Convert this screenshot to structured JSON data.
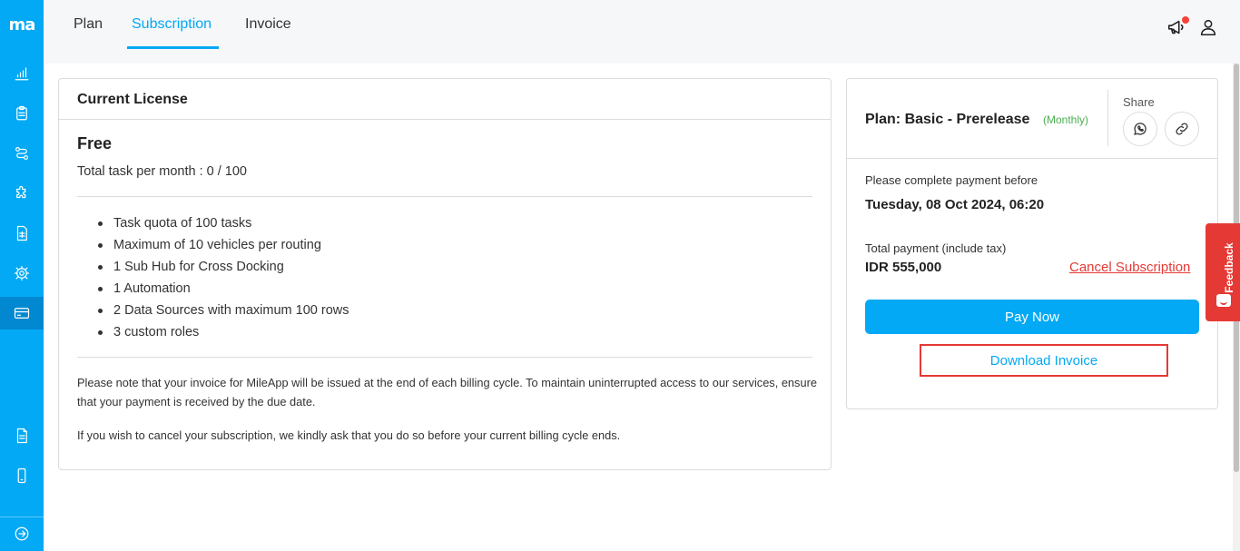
{
  "app": {
    "logo_text": "ma"
  },
  "sidebar": {
    "items": [
      {
        "icon": "bar-chart-icon"
      },
      {
        "icon": "clipboard-icon"
      },
      {
        "icon": "route-icon"
      },
      {
        "icon": "puzzle-icon"
      },
      {
        "icon": "spreadsheet-icon"
      },
      {
        "icon": "gear-icon"
      },
      {
        "icon": "credit-card-icon",
        "active": true
      },
      {
        "icon": "document-icon"
      },
      {
        "icon": "mobile-icon"
      },
      {
        "icon": "arrow-right-circle-icon"
      }
    ]
  },
  "header": {
    "tabs": [
      {
        "label": "Plan"
      },
      {
        "label": "Subscription",
        "active": true
      },
      {
        "label": "Invoice"
      }
    ]
  },
  "license": {
    "title": "Current License",
    "plan": "Free",
    "quota": "Total task per month : 0 / 100",
    "features": [
      "Task quota of 100 tasks",
      "Maximum of 10 vehicles per routing",
      "1 Sub Hub for Cross Docking",
      "1 Automation",
      "2 Data Sources with maximum 100 rows",
      "3 custom roles"
    ],
    "note1": "Please note that your invoice for MileApp will be issued at the end of each billing cycle. To maintain uninterrupted access to our services, ensure that your payment is received by the due date.",
    "note2": "If you wish to cancel your subscription, we kindly ask that you do so before your current billing cycle ends."
  },
  "payment": {
    "plan_name": "Plan: Basic - Prerelease",
    "cycle": "(Monthly)",
    "share_label": "Share",
    "due_label": "Please complete payment before",
    "due_date": "Tuesday, 08 Oct 2024, 06:20",
    "total_label": "Total payment (include tax)",
    "amount": "IDR 555,000",
    "cancel_label": "Cancel Subscription",
    "pay_label": "Pay Now",
    "download_label": "Download Invoice"
  },
  "feedback": {
    "label": "Feedback"
  },
  "colors": {
    "accent": "#03a9f4",
    "danger": "#e53935",
    "success": "#4caf50"
  }
}
